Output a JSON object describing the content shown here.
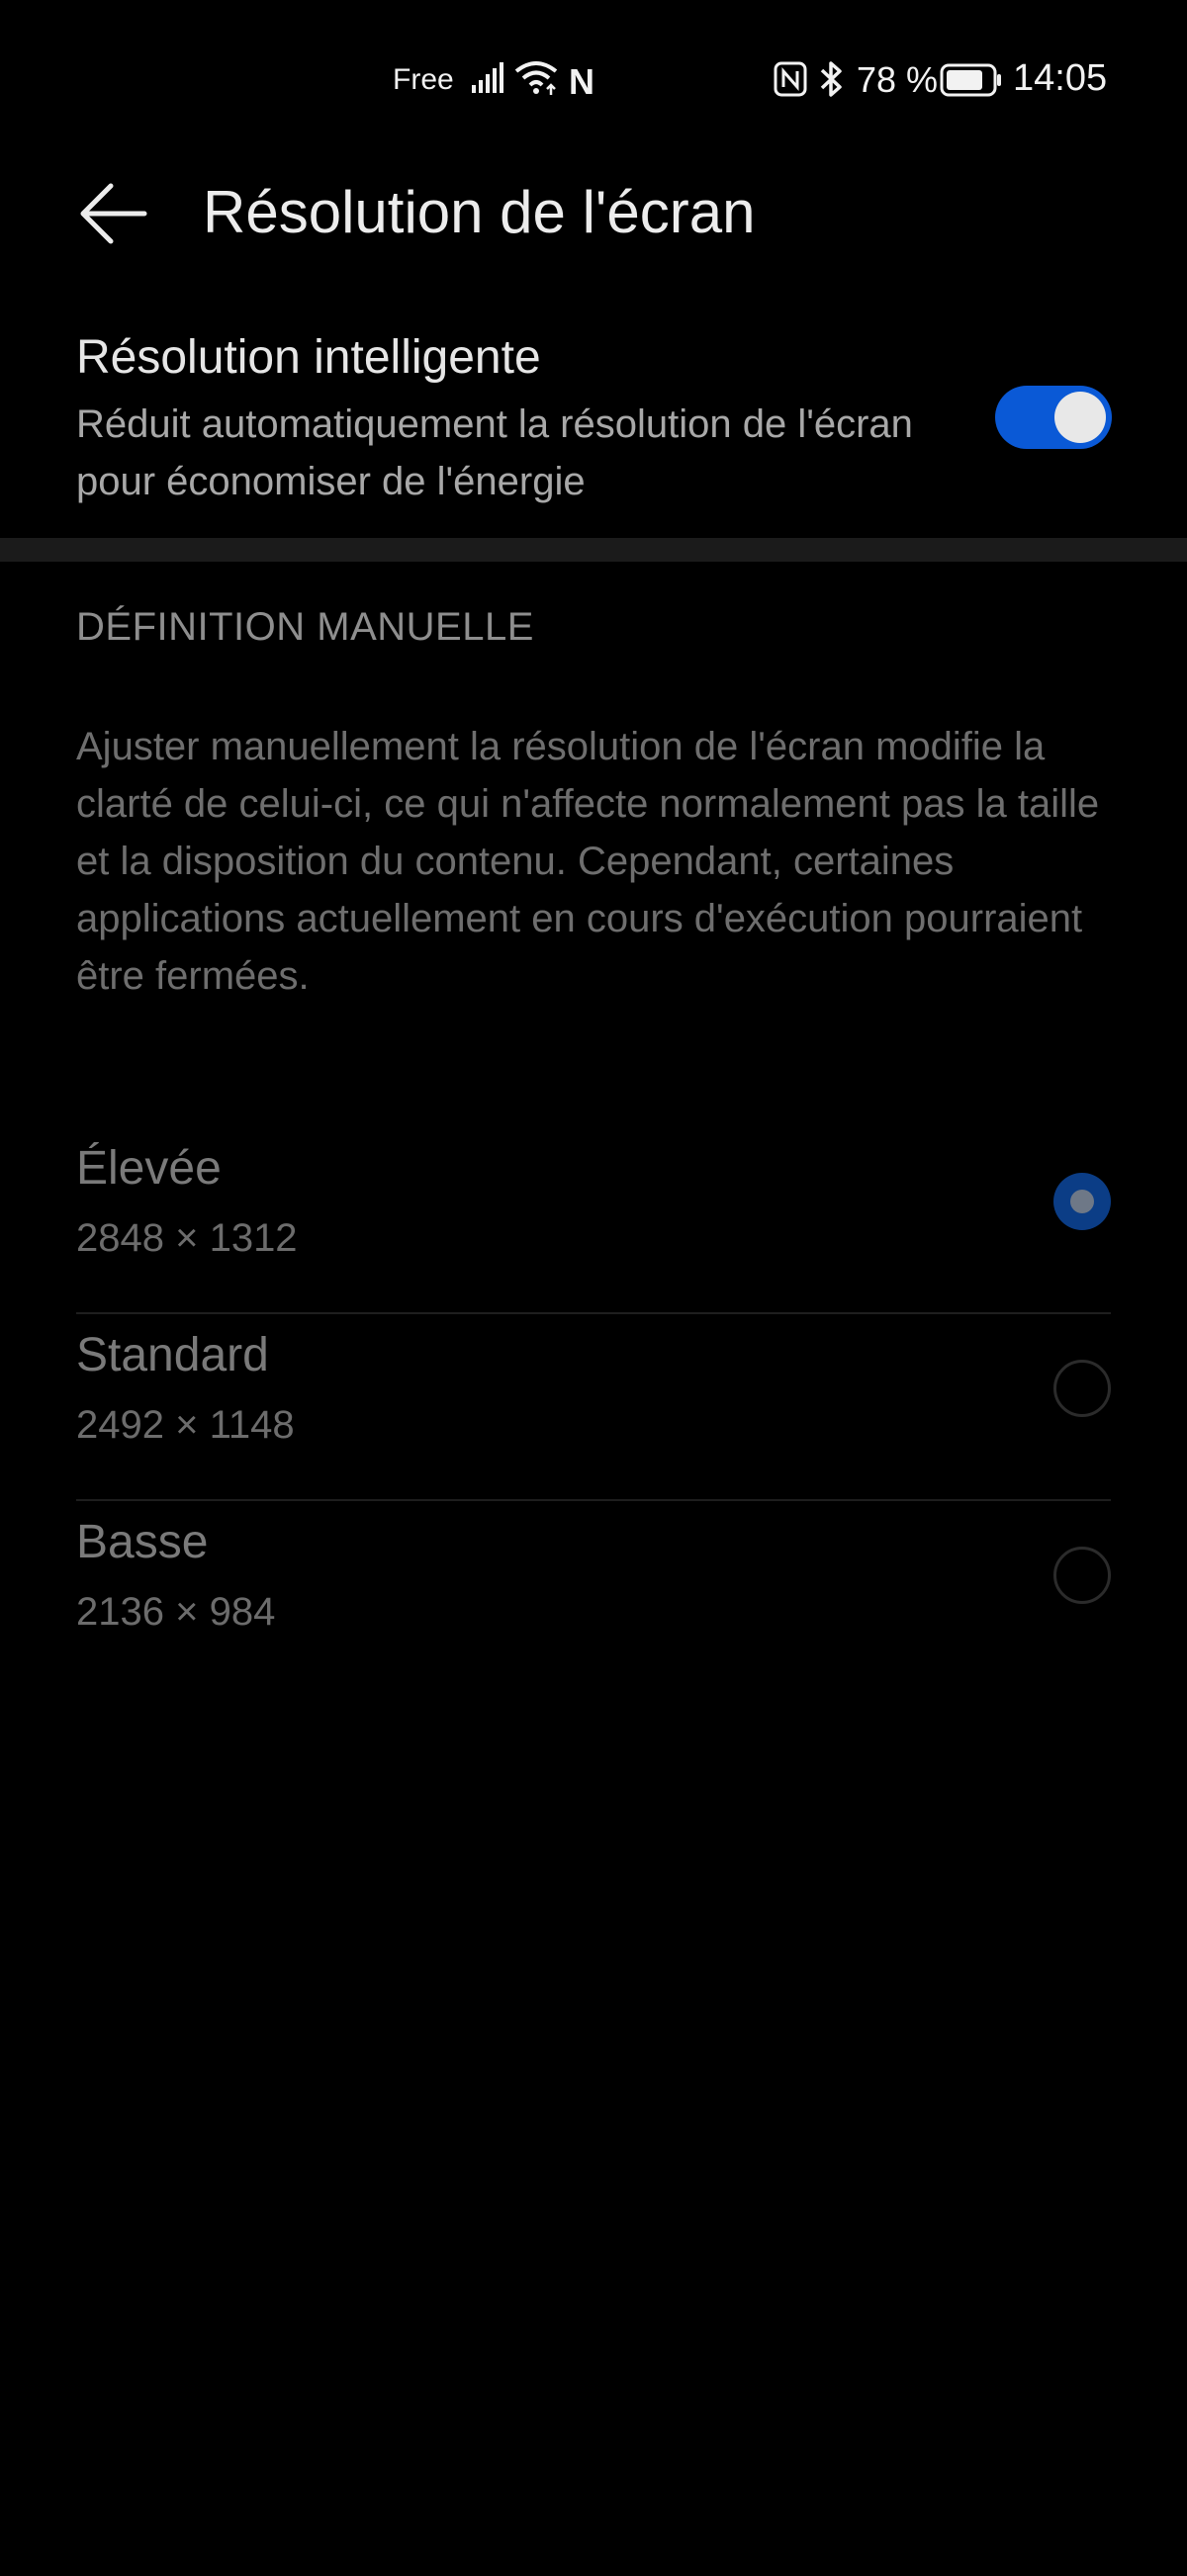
{
  "status_bar": {
    "carrier": "Free",
    "battery_pct": "78 %",
    "time": "14:05",
    "icons": [
      "signal-icon",
      "wifi-icon",
      "n-icon",
      "nfc-icon",
      "bluetooth-icon",
      "battery-icon"
    ]
  },
  "header": {
    "title": "Résolution de l'écran",
    "back_icon": "back-arrow-icon"
  },
  "smart": {
    "title": "Résolution intelligente",
    "description": "Réduit automatiquement la résolution de l'écran pour économiser de l'énergie",
    "enabled": true
  },
  "manual": {
    "section_title": "DÉFINITION MANUELLE",
    "description": "Ajuster manuellement la résolution de l'écran modifie la clarté de celui-ci, ce qui n'affecte normalement pas la taille et la disposition du contenu. Cependant, certaines applications actuellement en cours d'exécution pourraient être fermées.",
    "options": [
      {
        "label": "Élevée",
        "value": "2848 × 1312",
        "selected": true
      },
      {
        "label": "Standard",
        "value": "2492 × 1148",
        "selected": false
      },
      {
        "label": "Basse",
        "value": "2136 × 984",
        "selected": false
      }
    ]
  },
  "colors": {
    "background": "#000000",
    "accent": "#0a59d6"
  }
}
